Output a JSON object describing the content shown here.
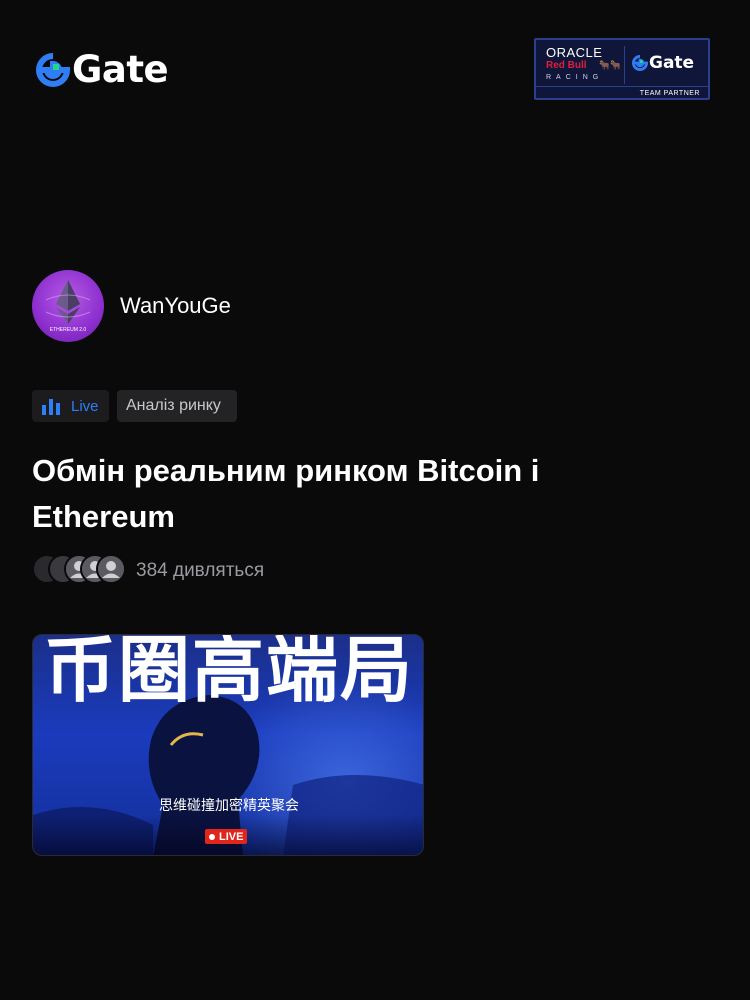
{
  "header": {
    "logo_text": "Gate",
    "partner_badge": {
      "line1": "ORACLE",
      "line2": "Red Bull",
      "line3": "RACING",
      "brand": "Gate",
      "footer": "TEAM PARTNER"
    }
  },
  "author": {
    "name": "WanYouGe",
    "avatar_caption": "ETHEREUM 2.0"
  },
  "tags": {
    "live_label": "Live",
    "category_label": "Аналіз ринку"
  },
  "stream": {
    "title": "Обмін реальним ринком Bitcoin і Ethereum",
    "viewers_text": "384 дивляться"
  },
  "thumbnail": {
    "headline": "币圈高端局",
    "subtitle": "思维碰撞加密精英聚会",
    "live_badge": "LIVE"
  },
  "colors": {
    "background": "#0a0a0b",
    "brand_blue": "#2f7ef5",
    "brand_green": "#1fd88b",
    "live_red": "#e0261c"
  },
  "icons": {
    "live_tag": "bar-chart-icon",
    "viewer": "user-avatar-icon"
  }
}
